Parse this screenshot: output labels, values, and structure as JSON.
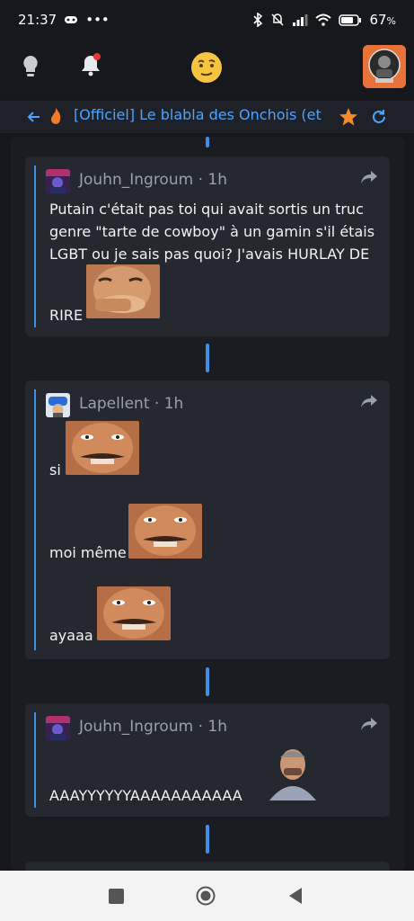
{
  "status": {
    "time": "21:37",
    "battery": "67",
    "battery_unit": "%"
  },
  "appbar": {
    "icons": [
      "lightbulb-icon",
      "bell-icon",
      "smiley-emoji-icon",
      "profile-avatar"
    ],
    "notification_dot_color": "#e53935"
  },
  "topic": {
    "title": "[Officiel] Le blabla des Onchois (et",
    "accent": "#4da3ff",
    "star_color": "#f28c28"
  },
  "posts": [
    {
      "author": "Jouhn_Ingroum",
      "separator": "·",
      "time": "1h",
      "lines": [
        "Putain c'était pas toi qui avait sortis un truc",
        "genre \"tarte de cowboy\" à un gamin s'il étais",
        "LGBT ou je sais pas quoi? J'avais HURLAY DE"
      ],
      "last_line": "RIRE"
    },
    {
      "author": "Lapellent",
      "separator": "·",
      "time": "1h",
      "lines": [
        "si",
        "moi même",
        "ayaaa"
      ]
    },
    {
      "author": "Jouhn_Ingroum",
      "separator": "·",
      "time": "1h",
      "lines": [
        "AAAYYYYYYAAAAAAAAAAA"
      ]
    }
  ],
  "colors": {
    "background": "#15171c",
    "card": "#25282f",
    "connector": "#3d8fe8"
  }
}
